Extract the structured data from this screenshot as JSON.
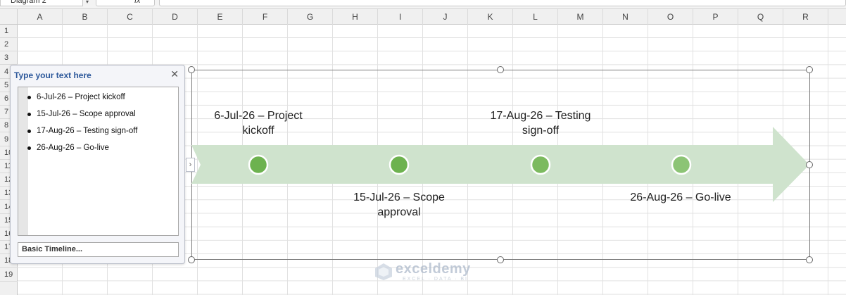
{
  "formula_bar": {
    "name_box": "Diagram 2",
    "fx_label": "fx"
  },
  "columns": [
    "A",
    "B",
    "C",
    "D",
    "E",
    "F",
    "G",
    "H",
    "I",
    "J",
    "K",
    "L",
    "M",
    "N",
    "O",
    "P",
    "Q",
    "R"
  ],
  "rows": [
    "1",
    "2",
    "3",
    "4",
    "5",
    "6",
    "7",
    "8",
    "9",
    "10",
    "11",
    "12",
    "13",
    "14",
    "15",
    "16",
    "17",
    "18",
    "19"
  ],
  "text_pane": {
    "title": "Type your text here",
    "items": [
      "6-Jul-26 – Project kickoff",
      "15-Jul-26 – Scope approval",
      "17-Aug-26 – Testing sign-off",
      "26-Aug-26 – Go-live"
    ],
    "footer_link": "Basic Timeline..."
  },
  "timeline": {
    "arrow_color": "#cfe3cd",
    "events": [
      {
        "line1": "6-Jul-26 – Project",
        "line2": "kickoff",
        "color": "#6db24f"
      },
      {
        "line1": "15-Jul-26 – Scope",
        "line2": "approval",
        "color": "#6db24f"
      },
      {
        "line1": "17-Aug-26 – Testing",
        "line2": "sign-off",
        "color": "#7cba5f"
      },
      {
        "line1": "26-Aug-26 – Go-live",
        "line2": "",
        "color": "#8cc475"
      }
    ]
  },
  "watermark": {
    "name": "exceldemy",
    "tagline": "EXCEL · DATA · BI"
  }
}
